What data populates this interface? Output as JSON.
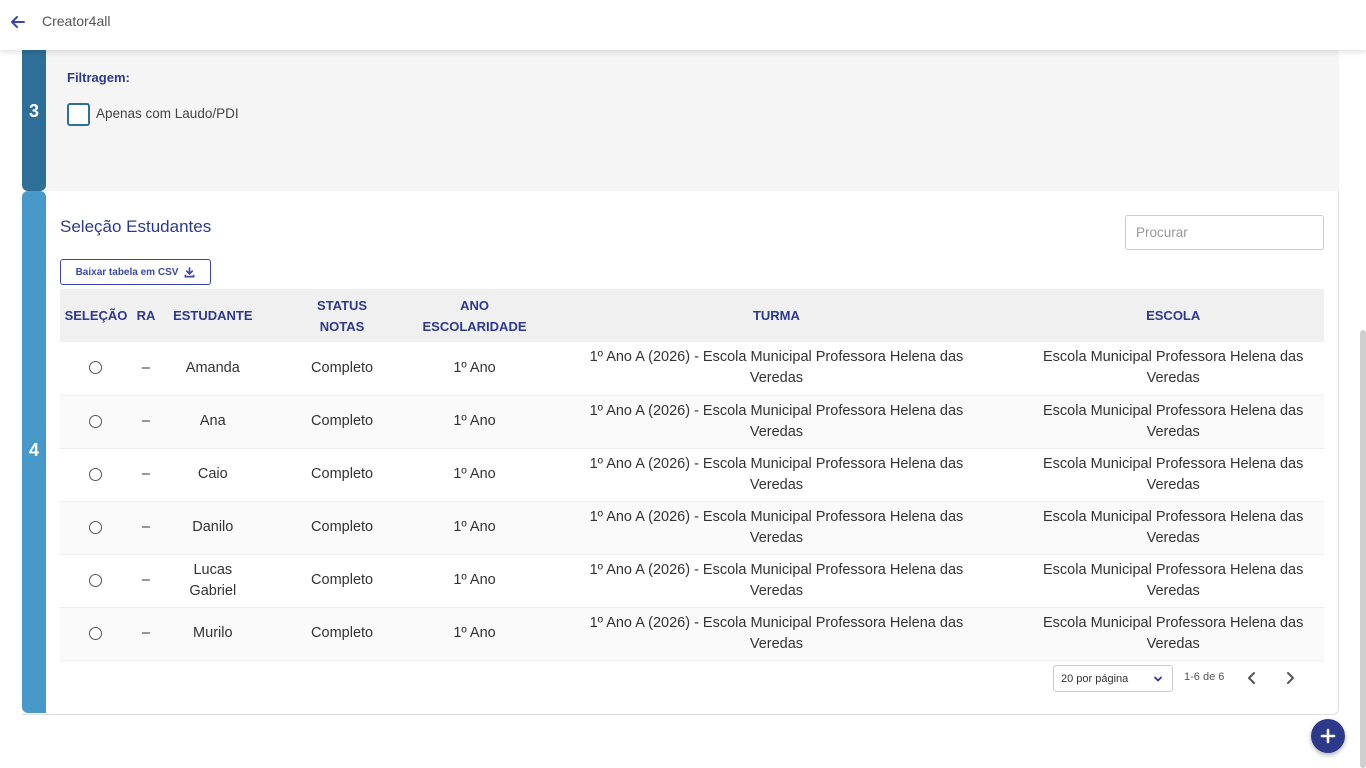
{
  "header": {
    "title": "Creator4all"
  },
  "step3": {
    "number": "3",
    "filter_label": "Filtragem:",
    "checkbox_label": "Apenas com Laudo/PDI",
    "checkbox_checked": false
  },
  "step4": {
    "number": "4",
    "title": "Seleção Estudantes",
    "search_placeholder": "Procurar",
    "csv_button": "Baixar tabela em CSV",
    "columns": {
      "selecao": "SELEÇÃO",
      "ra": "RA",
      "estudante": "ESTUDANTE",
      "status_notas": "STATUS NOTAS",
      "ano_escolaridade": "ANO ESCOLARIDADE",
      "turma": "TURMA",
      "escola": "ESCOLA"
    },
    "rows": [
      {
        "ra": "–",
        "estudante": "Amanda",
        "status": "Completo",
        "ano": "1º Ano",
        "turma": "1º Ano A (2026) - Escola Municipal Professora Helena das Veredas",
        "escola": "Escola Municipal Professora Helena das Veredas"
      },
      {
        "ra": "–",
        "estudante": "Ana",
        "status": "Completo",
        "ano": "1º Ano",
        "turma": "1º Ano A (2026) - Escola Municipal Professora Helena das Veredas",
        "escola": "Escola Municipal Professora Helena das Veredas"
      },
      {
        "ra": "–",
        "estudante": "Caio",
        "status": "Completo",
        "ano": "1º Ano",
        "turma": "1º Ano A (2026) - Escola Municipal Professora Helena das Veredas",
        "escola": "Escola Municipal Professora Helena das Veredas"
      },
      {
        "ra": "–",
        "estudante": "Danilo",
        "status": "Completo",
        "ano": "1º Ano",
        "turma": "1º Ano A (2026) - Escola Municipal Professora Helena das Veredas",
        "escola": "Escola Municipal Professora Helena das Veredas"
      },
      {
        "ra": "–",
        "estudante": "Lucas Gabriel",
        "status": "Completo",
        "ano": "1º Ano",
        "turma": "1º Ano A (2026) - Escola Municipal Professora Helena das Veredas",
        "escola": "Escola Municipal Professora Helena das Veredas"
      },
      {
        "ra": "–",
        "estudante": "Murilo",
        "status": "Completo",
        "ano": "1º Ano",
        "turma": "1º Ano A (2026) - Escola Municipal Professora Helena das Veredas",
        "escola": "Escola Municipal Professora Helena das Veredas"
      }
    ],
    "pagination": {
      "per_page": "20 por página",
      "range": "1-6 de 6"
    }
  },
  "icons": {
    "back": "arrow-left-icon",
    "download": "download-icon",
    "chevron_down": "chevron-down-icon",
    "prev": "chevron-left-icon",
    "next": "chevron-right-icon",
    "fab": "plus-icon"
  },
  "colors": {
    "primary": "#2d3a8c",
    "step3_bar": "#2e6f99",
    "step4_bar": "#4699c9",
    "back_arrow": "#3b48a8"
  }
}
